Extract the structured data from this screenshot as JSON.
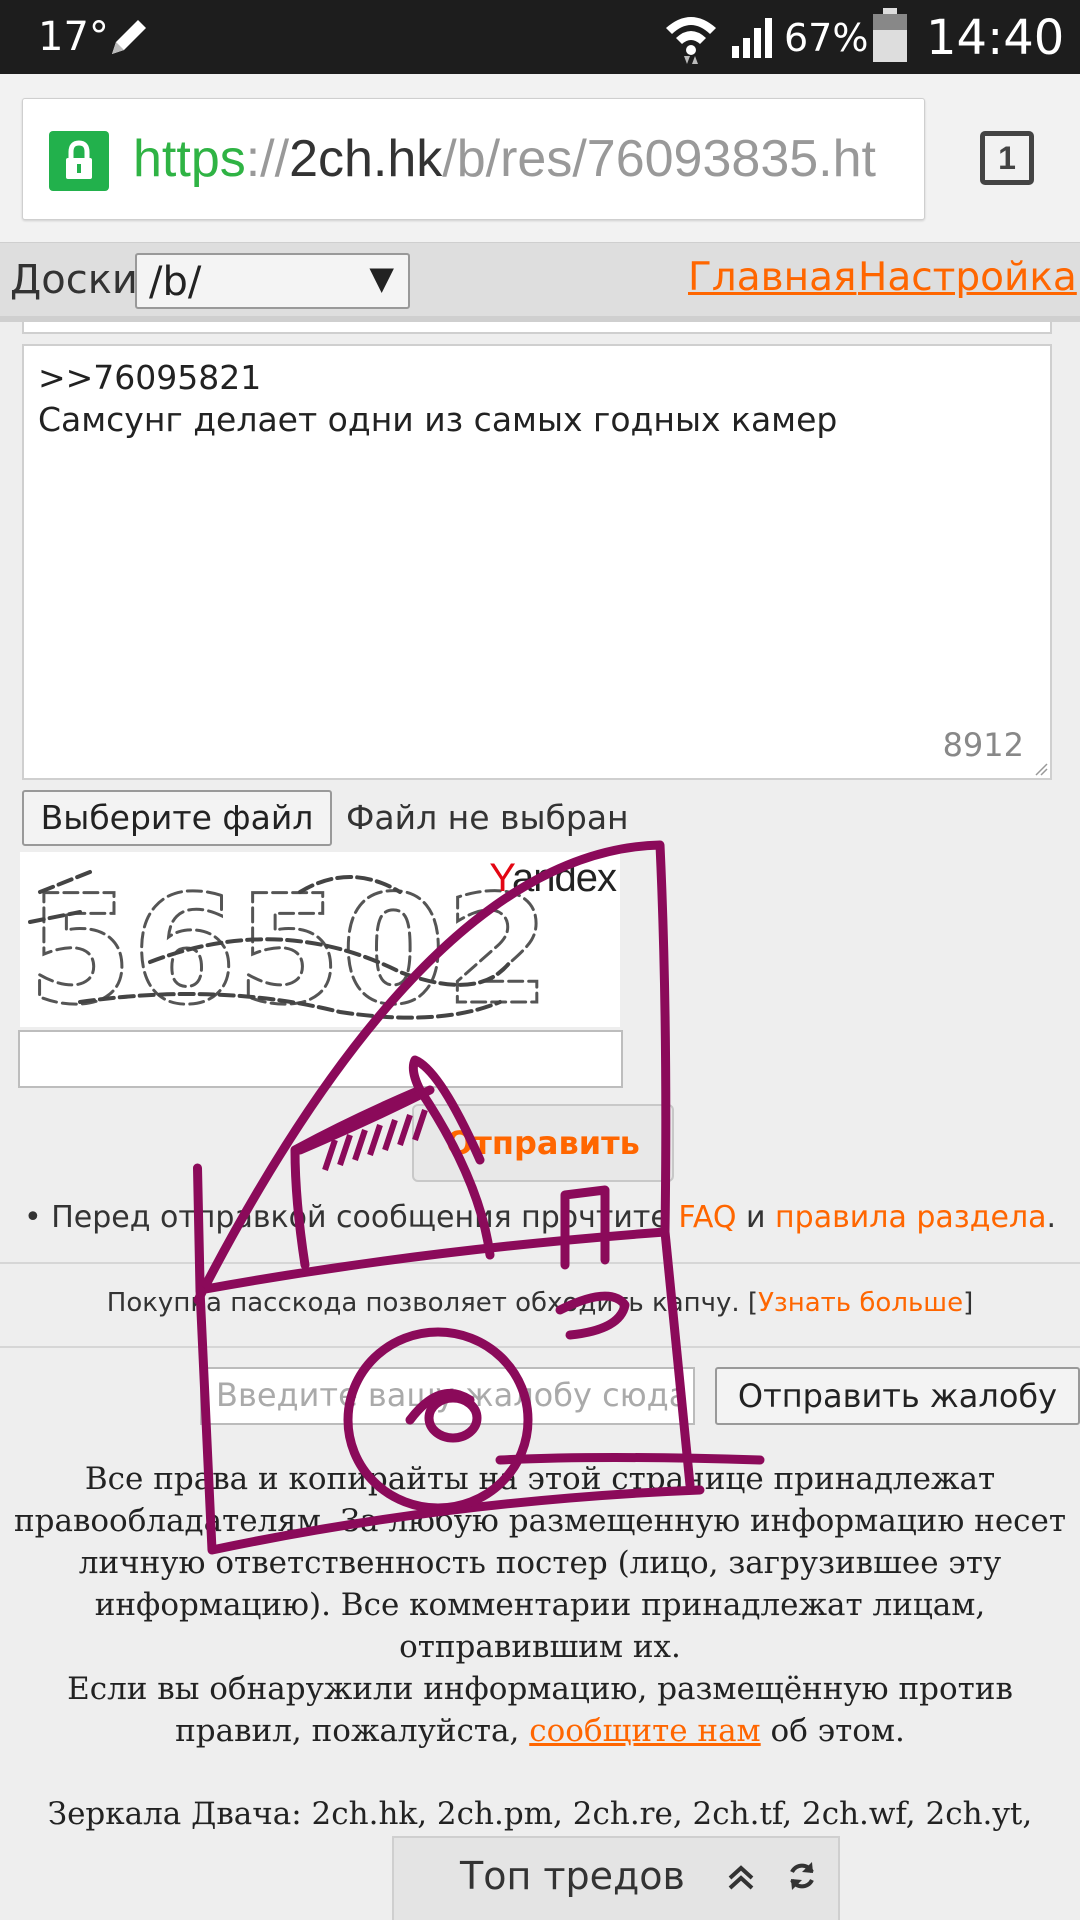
{
  "status_bar": {
    "temperature": "17°",
    "battery_percent": "67%",
    "time": "14:40",
    "icons": [
      "pencil-icon",
      "wifi-icon",
      "signal-icon",
      "battery-icon"
    ]
  },
  "browser": {
    "url_scheme": "https",
    "url_sep": "://",
    "url_host": "2ch.hk",
    "url_path": "/b/res/76093835.ht",
    "tab_count": "1"
  },
  "boards": {
    "label": "Доски",
    "selected": "/b/",
    "main_link": "Главная",
    "settings_link": "Настройка"
  },
  "form": {
    "message_line1": ">>76095821",
    "message_line2": "Самсунг делает одни из самых годных камер",
    "char_counter": "8912",
    "file_button": "Выберите файл",
    "file_status": "Файл не выбран",
    "captcha_brand_y": "Y",
    "captcha_brand_rest": "andex",
    "captcha_text": "56502",
    "submit": "Отправить"
  },
  "rules_notice": {
    "bullet": "• ",
    "prefix": "Перед отправкой сообщения прочтите ",
    "faq": "FAQ",
    "and": " и ",
    "rules_link": "правила раздела",
    "suffix": "."
  },
  "passcode": {
    "text": "Покупка пасскода позволяет обходить капчу. [",
    "link": "Узнать больше",
    "close": "]"
  },
  "complaint": {
    "placeholder": "Введите вашу жалобу сюда",
    "button": "Отправить жалобу"
  },
  "footer": {
    "copyright": "Все права и копирайты на этой странице принадлежат правообладателям. За любую размещенную информацию несет личную ответственность постер (лицо, загрузившее эту информацию). Все комментарии принадлежат лицам, отправившим их.",
    "report_prefix": "Если вы обнаружили информацию, размещённую против правил, пожалуйста, ",
    "report_link": "сообщите нам",
    "report_suffix": " об этом.",
    "mirrors": "Зеркала Двача: 2ch.hk, 2ch.pm, 2ch.re, 2ch.tf, 2ch.wf, 2ch.yt,"
  },
  "top_threads": {
    "label": "Топ тредов"
  },
  "colors": {
    "accent": "#ff6600",
    "doodle": "#8b0a5a",
    "https": "#2fb344"
  }
}
